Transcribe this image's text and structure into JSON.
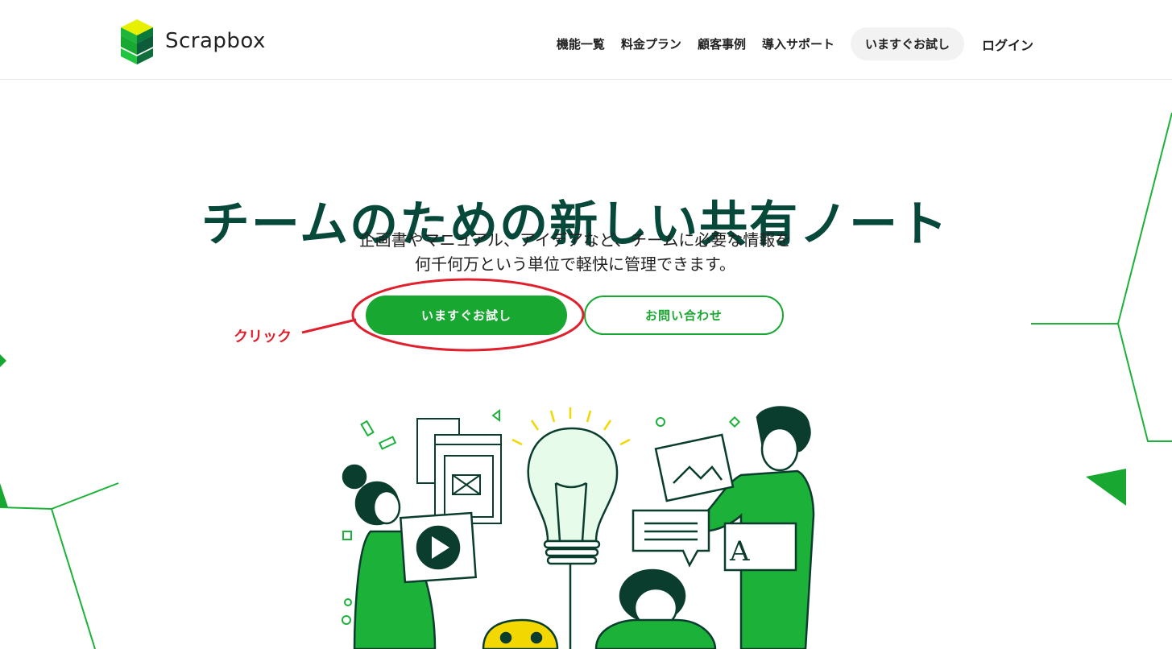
{
  "brand": {
    "name": "Scrapbox"
  },
  "nav": {
    "items": [
      "機能一覧",
      "料金プラン",
      "顧客事例",
      "導入サポート"
    ],
    "trial_label": "いますぐお試し",
    "login_label": "ログイン"
  },
  "hero": {
    "title": "チームのための新しい共有ノート",
    "subtitle_line1": "企画書やマニュアル、アイデアなど、チームに必要な情報を",
    "subtitle_line2": "何千何万という単位で軽快に管理できます。",
    "primary_button": "いますぐお試し",
    "secondary_button": "お問い合わせ"
  },
  "annotation": {
    "label": "クリック"
  },
  "colors": {
    "brand_green": "#18a831",
    "title_green": "#06483a",
    "annotation_red": "#e0202c"
  }
}
